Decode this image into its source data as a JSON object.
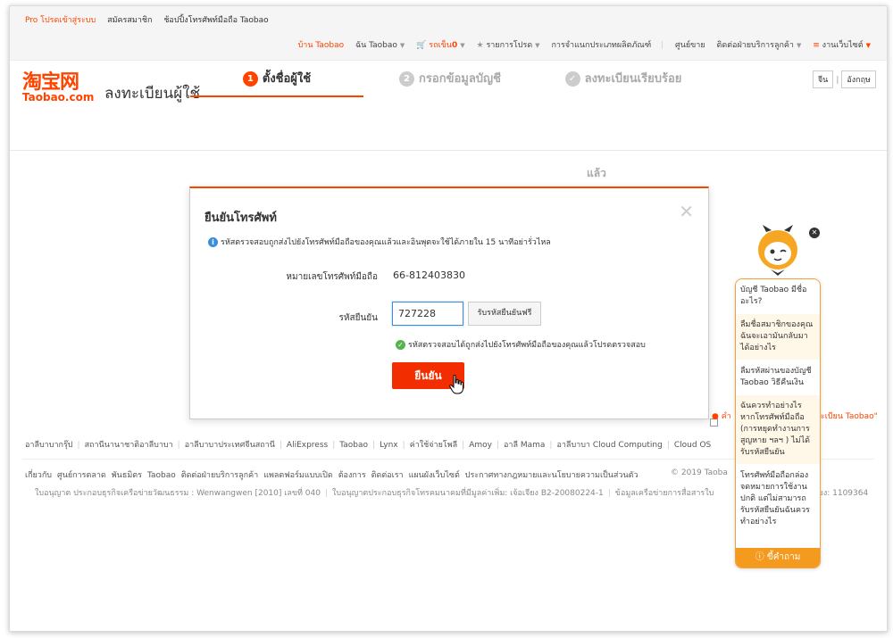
{
  "topbar": {
    "promo": "Pro โปรดเข้าสู่ระบบ",
    "register": "สมัครสมาชิก",
    "mobile": "ช้อปปิ้งโทรศัพท์มือถือ Taobao"
  },
  "topnav": {
    "home": "บ้าน Taobao",
    "my": "ฉัน Taobao",
    "cart": "รถเข็น",
    "cart_count": "0",
    "favorites": "รายการโปรด",
    "categories": "การจำแนกประเภทผลิตภัณฑ์",
    "seller": "ศูนย์ขาย",
    "service": "ติดต่อฝ่ายบริการลูกค้า",
    "sitemap": "งานเว็บไซต์"
  },
  "header": {
    "logo_cn": "淘宝网",
    "logo_en": "Taobao.com",
    "title": "ลงทะเบียนผู้ใช้"
  },
  "steps": [
    {
      "num": "1",
      "label": "ตั้งชื่อผู้ใช้"
    },
    {
      "num": "2",
      "label": "กรอกข้อมูลบัญชี"
    },
    {
      "num": "✓",
      "label": "ลงทะเบียนเรียบร้อย",
      "label_cont": "แล้ว"
    }
  ],
  "lang": {
    "cn": "จีน",
    "en": "อังกฤษ"
  },
  "dialog": {
    "title": "ยืนยันโทรศัพท์",
    "info": "รหัสตรวจสอบถูกส่งไปยังโทรศัพท์มือถือของคุณแล้วและอินพุตจะใช้ได้ภายใน 15 นาทีอย่ารั่วไหล",
    "phone_label": "หมายเลขโทรศัพท์มือถือ",
    "phone_value": "66-812403830",
    "code_label": "รหัสยืนยัน",
    "code_value": "727228",
    "get_code": "รับรหัสยืนยันฟรี",
    "ok_msg": "รหัสตรวจสอบได้ถูกส่งไปยังโทรศัพท์มือถือของคุณแล้วโปรดตรวจสอบ",
    "confirm": "ยืนยัน"
  },
  "side_link_a": "คำ",
  "side_link_b": "ทะเบียน Taobao\"",
  "footer_links": [
    "อาลีบาบากรุ๊ป",
    "สถานีนานาชาติอาลีบาบา",
    "อาลีบาบาประเทศจีนสถานี",
    "AliExpress",
    "Taobao",
    "Lynx",
    "ค่าใช้จ่ายโพลี",
    "Amoy",
    "อาลี Mama",
    "อาลีบาบา Cloud Computing",
    "Cloud OS"
  ],
  "footer_about": [
    "เกี่ยวกับ",
    "ศูนย์การตลาด",
    "พันธมิตร",
    "Taobao",
    "ติดต่อฝ่ายบริการลูกค้า",
    "แพลตฟอร์มแบบเปิด",
    "ต้องการ",
    "ติดต่อเรา",
    "แผนผังเว็บไซต์",
    "ประกาศทางกฎหมายและนโยบายความเป็นส่วนตัว"
  ],
  "copyright": "© 2019 Taoba",
  "footer_license": [
    "ใบอนุญาต  ประกอบธุรกิจเครือข่ายวัฒนธรรม  : Wenwangwen  [2010] เลขที่ 040",
    "ใบอนุญาตประกอบธุรกิจโทรคมนาคมที่มีมูลค่าเพิ่ม: เจ้อเจียง B2-20080224-1",
    "ข้อมูลเครือข่ายการสื่อสารใบ"
  ],
  "footer_license_b": "เสียง: 1109364",
  "help": {
    "questions": [
      "บัญชี Taobao มีชื่ออะไร?",
      "ลืมชื่อสมาชิกของคุณฉันจะเอามันกลับมาได้อย่างไร",
      "ลืมรหัสผ่านของบัญชี Taobao วิธีคืนเงิน",
      "ฉันควรทำอย่างไรหากโทรศัพท์มือถือ (การหยุดทำงานการสูญหาย ฯลฯ ) ไม่ได้รับรหัสยืนยัน",
      "โทรศัพท์มือถือกล่องจดหมายการใช้งานปกติ แต่ไม่สามารถรับรหัสยืนยันฉันควรทำอย่างไร"
    ],
    "ask": "ขี้คำถาม"
  },
  "colors": {
    "accent": "#ff4400",
    "confirm": "#f22e00",
    "help_orange": "#f39a1f",
    "info_blue": "#3c8dde",
    "ok_green": "#56b44c"
  }
}
